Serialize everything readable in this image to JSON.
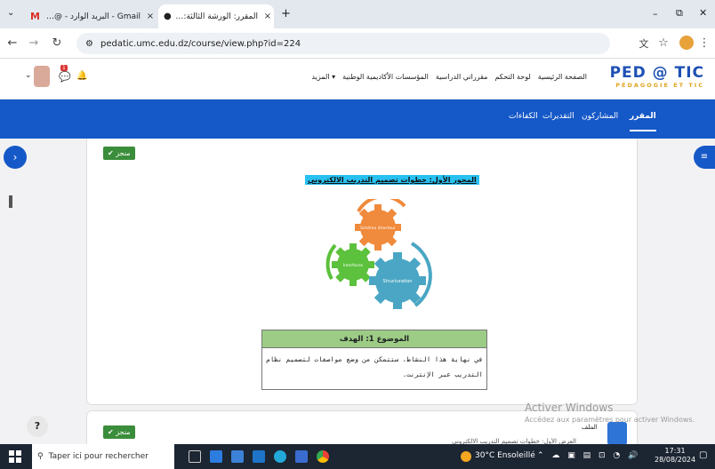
{
  "browser": {
    "tabs": [
      {
        "title": "Gmail ‑ البريد الوارد ‑ @gmail.com",
        "close": "×"
      },
      {
        "title": "المقرر: الورشة الثالثة: منهجية تص…",
        "close": "×"
      }
    ],
    "new_tab": "+",
    "url": "pedatic.umc.edu.dz/course/view.php?id=224",
    "window": {
      "minimize": "–",
      "maximize": "⧉",
      "close": "✕"
    }
  },
  "site": {
    "logo_main": "PED @ TIC",
    "logo_sub": "PÉDAGOGIE ET TIC",
    "menu": [
      "الصفحة الرئيسية",
      "لوحة التحكم",
      "مقرراتي الدراسية",
      "المؤسسات الأكاديمية الوطنية",
      "المزيد ▾"
    ],
    "notification_count": "1"
  },
  "course_nav": [
    "المقرر",
    "المشاركون",
    "التقديرات",
    "الكفاءات"
  ],
  "content": {
    "done_label": "✔ منجز",
    "section_title": "المحور الأول: خطوات تصميم التدريب الالكتروني",
    "gears": [
      "Schéma directeur",
      "Interfaces",
      "Structuration"
    ],
    "table_header": "الموضوع 1: الهدف",
    "table_text": "في نهاية هذا النشاط، ستتمكن من وضع مواصفات لتصميم نظام التدريب عبر الإنترنت.",
    "file_label": "الملف",
    "file_desc": "العرض الأول: خطوات تصميم التدريب الالكتروني",
    "help": "?"
  },
  "watermark": {
    "line1": "Activer Windows",
    "line2": "Accédez aux paramètres pour activer Windows."
  },
  "taskbar": {
    "search": "Taper ici pour rechercher",
    "weather": "30°C Ensoleillé",
    "time": "17:31",
    "date": "28/08/2024"
  },
  "colors": {
    "nav_blue": "#1558c8",
    "done_green": "#3a8d3a",
    "logo_blue": "#1e50b4",
    "table_header": "#9ccc85",
    "gear_orange": "#f08a3c",
    "gear_green": "#5cc13c",
    "gear_teal": "#4aa6c4"
  }
}
